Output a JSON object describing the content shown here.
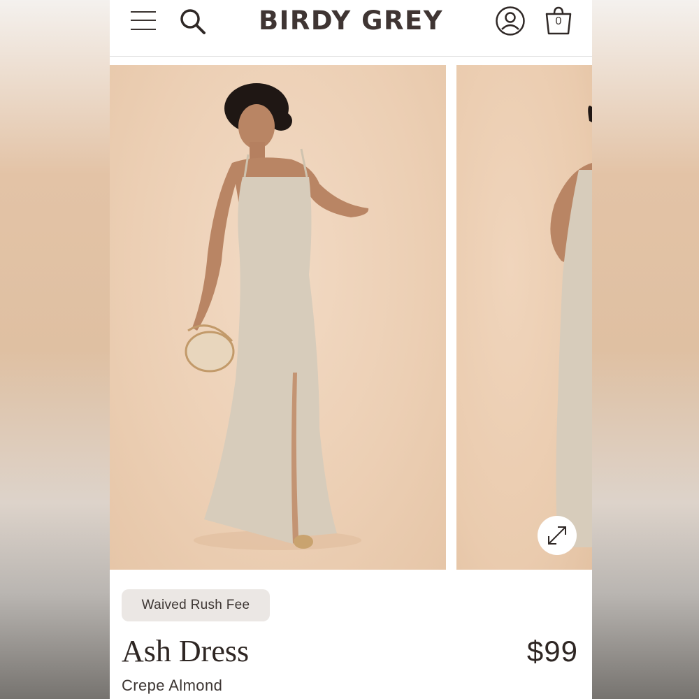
{
  "header": {
    "brand": "BIRDY GREY",
    "bag_count": "0"
  },
  "icons": {
    "menu": "hamburger-menu-icon",
    "search": "search-icon",
    "account": "account-icon",
    "bag": "shopping-bag-icon",
    "expand": "expand-arrows-icon"
  },
  "gallery": {
    "images": [
      {
        "name": "model wearing dress front view"
      },
      {
        "name": "model wearing dress side view"
      }
    ]
  },
  "product": {
    "badge": "Waived Rush Fee",
    "title": "Ash Dress",
    "price": "$99",
    "color": "Crepe Almond"
  },
  "colors": {
    "background_tint": "#efd3b9",
    "dress": "#d7ccbb",
    "text_dark": "#2e2623",
    "badge_bg": "#ebe7e4"
  }
}
